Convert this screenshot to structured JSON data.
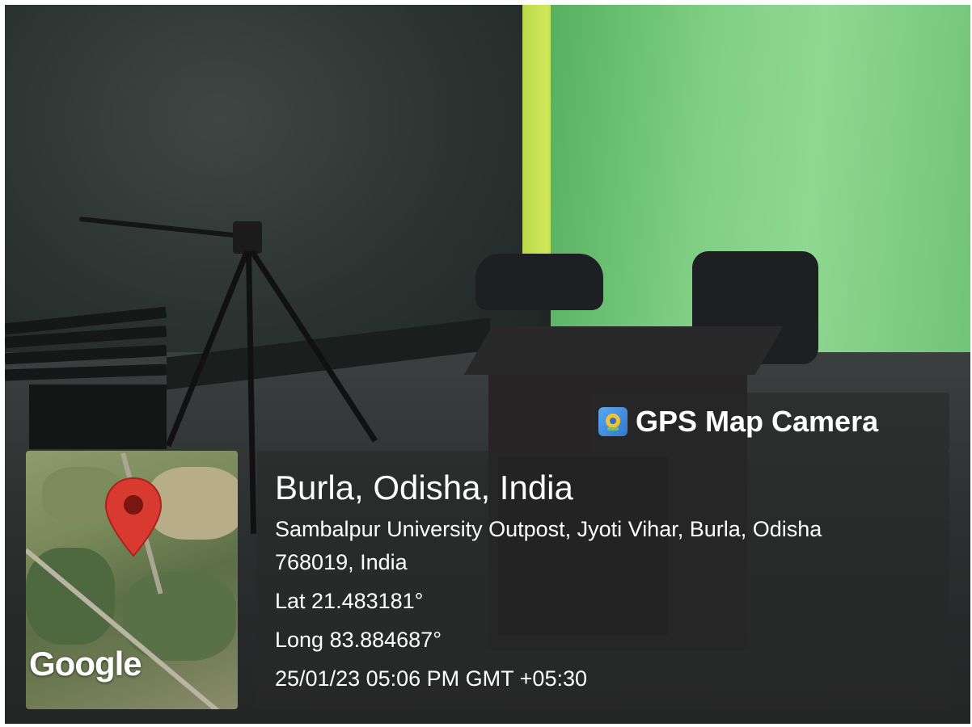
{
  "watermark": {
    "icon": "gps-map-camera-icon",
    "text": "GPS Map Camera"
  },
  "map": {
    "icon": "map-pin-icon",
    "attribution": "Google",
    "pin_color": "#d93a2f"
  },
  "location": {
    "title": "Burla, Odisha, India",
    "address_line1": "Sambalpur University Outpost, Jyoti Vihar, Burla, Odisha",
    "address_line2": "768019, India",
    "latitude": "Lat 21.483181°",
    "longitude": "Long 83.884687°",
    "timestamp": "25/01/23 05:06 PM GMT +05:30"
  },
  "colors": {
    "green_screen": "#7fcf83",
    "overlay": "#282828",
    "text": "#ffffff"
  }
}
